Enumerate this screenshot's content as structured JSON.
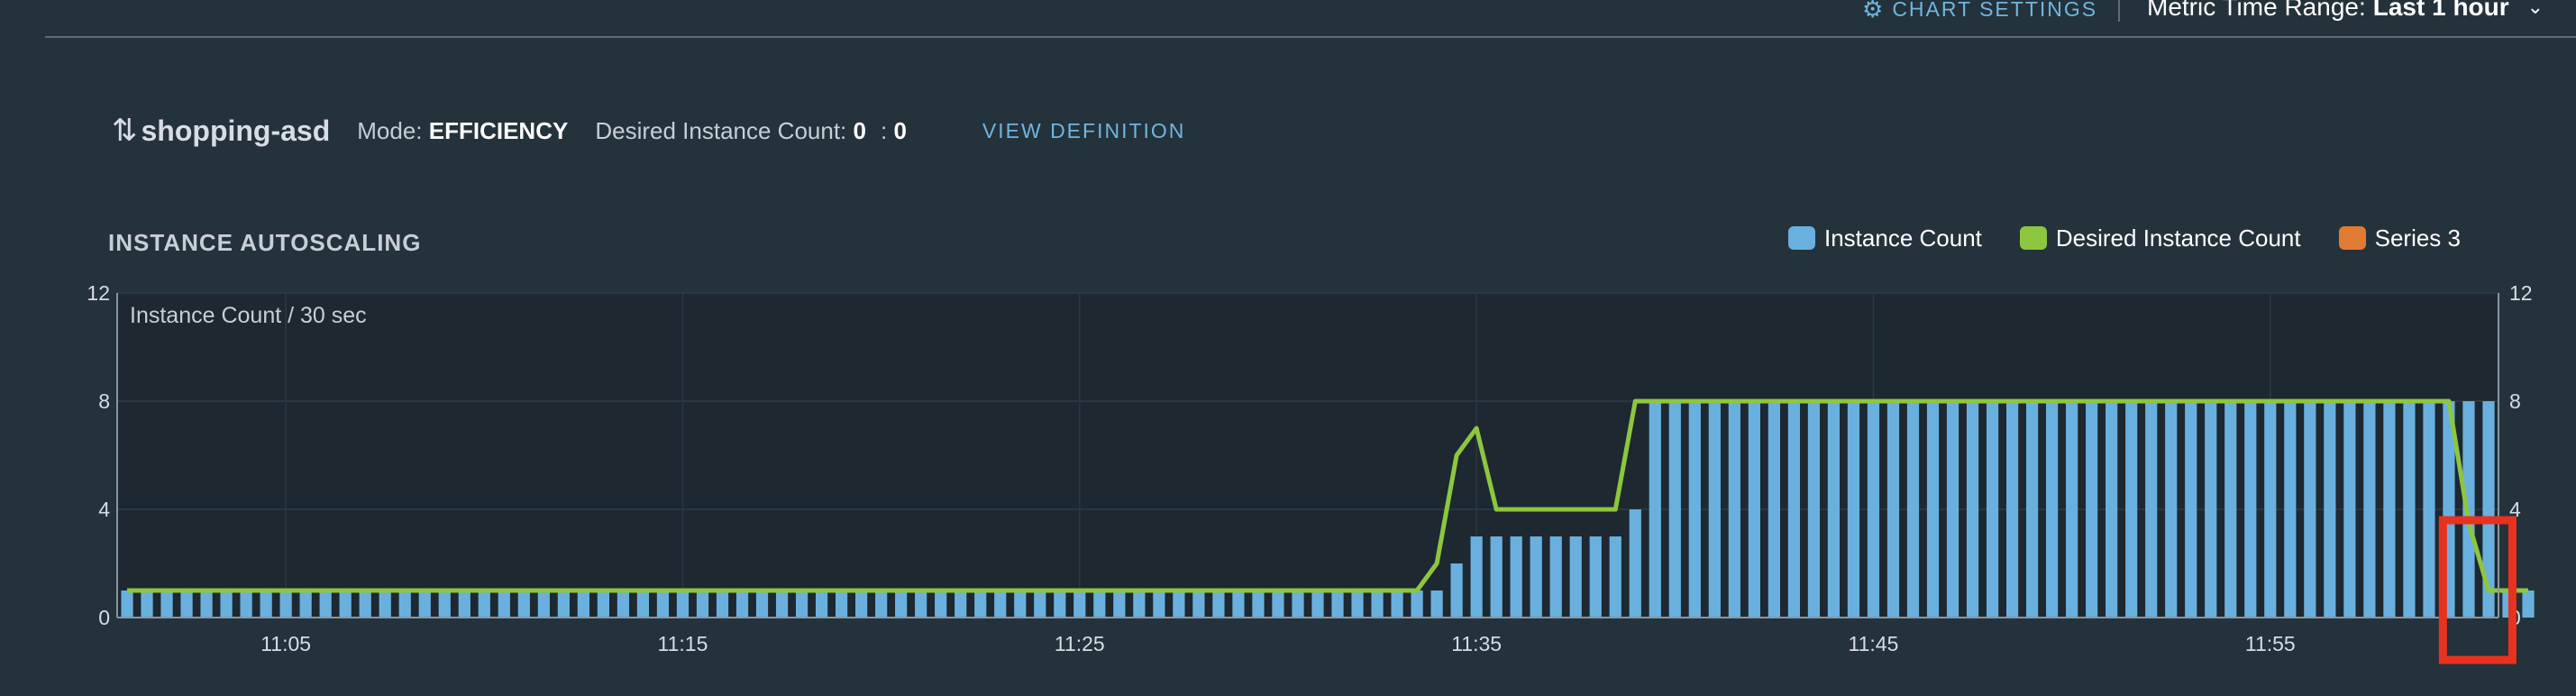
{
  "toolbar": {
    "chart_settings_label": "CHART SETTINGS",
    "time_range_label": "Metric Time Range:",
    "time_range_value": "Last 1 hour"
  },
  "header": {
    "app_name": "shopping-asd",
    "mode_label": "Mode:",
    "mode_value": "EFFICIENCY",
    "desired_label": "Desired Instance Count:",
    "desired_value": "0",
    "desired_second_value": "0",
    "view_definition_label": "VIEW DEFINITION"
  },
  "colors": {
    "instance_count": "#6ab0de",
    "desired_instance_count": "#8dc63f",
    "series_3": "#e07b32",
    "highlight": "#e8321f"
  },
  "chart_data": {
    "type": "bar",
    "title": "INSTANCE AUTOSCALING",
    "unit_label": "Instance Count / 30 sec",
    "ylim": [
      0,
      12
    ],
    "y_ticks": [
      "0",
      "4",
      "8",
      "12"
    ],
    "x_ticks": [
      {
        "label": "11:05",
        "index": 8
      },
      {
        "label": "11:15",
        "index": 28
      },
      {
        "label": "11:25",
        "index": 48
      },
      {
        "label": "11:35",
        "index": 68
      },
      {
        "label": "11:45",
        "index": 88
      },
      {
        "label": "11:55",
        "index": 108
      }
    ],
    "legend": [
      "Instance Count",
      "Desired Instance Count",
      "Series 3"
    ],
    "legend_position": "top-right",
    "x": [
      "11:01:00",
      "11:01:30",
      "11:02:00",
      "11:02:30",
      "11:03:00",
      "11:03:30",
      "11:04:00",
      "11:04:30",
      "11:05:00",
      "11:05:30",
      "11:06:00",
      "11:06:30",
      "11:07:00",
      "11:07:30",
      "11:08:00",
      "11:08:30",
      "11:09:00",
      "11:09:30",
      "11:10:00",
      "11:10:30",
      "11:11:00",
      "11:11:30",
      "11:12:00",
      "11:12:30",
      "11:13:00",
      "11:13:30",
      "11:14:00",
      "11:14:30",
      "11:15:00",
      "11:15:30",
      "11:16:00",
      "11:16:30",
      "11:17:00",
      "11:17:30",
      "11:18:00",
      "11:18:30",
      "11:19:00",
      "11:19:30",
      "11:20:00",
      "11:20:30",
      "11:21:00",
      "11:21:30",
      "11:22:00",
      "11:22:30",
      "11:23:00",
      "11:23:30",
      "11:24:00",
      "11:24:30",
      "11:25:00",
      "11:25:30",
      "11:26:00",
      "11:26:30",
      "11:27:00",
      "11:27:30",
      "11:28:00",
      "11:28:30",
      "11:29:00",
      "11:29:30",
      "11:30:00",
      "11:30:30",
      "11:31:00",
      "11:31:30",
      "11:32:00",
      "11:32:30",
      "11:33:00",
      "11:33:30",
      "11:34:00",
      "11:34:30",
      "11:35:00",
      "11:35:30",
      "11:36:00",
      "11:36:30",
      "11:37:00",
      "11:37:30",
      "11:38:00",
      "11:38:30",
      "11:39:00",
      "11:39:30",
      "11:40:00",
      "11:40:30",
      "11:41:00",
      "11:41:30",
      "11:42:00",
      "11:42:30",
      "11:43:00",
      "11:43:30",
      "11:44:00",
      "11:44:30",
      "11:45:00",
      "11:45:30",
      "11:46:00",
      "11:46:30",
      "11:47:00",
      "11:47:30",
      "11:48:00",
      "11:48:30",
      "11:49:00",
      "11:49:30",
      "11:50:00",
      "11:50:30",
      "11:51:00",
      "11:51:30",
      "11:52:00",
      "11:52:30",
      "11:53:00",
      "11:53:30",
      "11:54:00",
      "11:54:30",
      "11:55:00",
      "11:55:30",
      "11:56:00",
      "11:56:30",
      "11:57:00",
      "11:57:30",
      "11:58:00",
      "11:58:30",
      "11:59:00",
      "11:59:30",
      "12:00:00",
      "12:00:30"
    ],
    "series": [
      {
        "name": "Instance Count",
        "type": "bar",
        "values": [
          1,
          1,
          1,
          1,
          1,
          1,
          1,
          1,
          1,
          1,
          1,
          1,
          1,
          1,
          1,
          1,
          1,
          1,
          1,
          1,
          1,
          1,
          1,
          1,
          1,
          1,
          1,
          1,
          1,
          1,
          1,
          1,
          1,
          1,
          1,
          1,
          1,
          1,
          1,
          1,
          1,
          1,
          1,
          1,
          1,
          1,
          1,
          1,
          1,
          1,
          1,
          1,
          1,
          1,
          1,
          1,
          1,
          1,
          1,
          1,
          1,
          1,
          1,
          1,
          1,
          1,
          1,
          2,
          3,
          3,
          3,
          3,
          3,
          3,
          3,
          3,
          4,
          8,
          8,
          8,
          8,
          8,
          8,
          8,
          8,
          8,
          8,
          8,
          8,
          8,
          8,
          8,
          8,
          8,
          8,
          8,
          8,
          8,
          8,
          8,
          8,
          8,
          8,
          8,
          8,
          8,
          8,
          8,
          8,
          8,
          8,
          8,
          8,
          8,
          8,
          8,
          8,
          8,
          8,
          8,
          1,
          1
        ]
      },
      {
        "name": "Desired Instance Count",
        "type": "line",
        "values": [
          1,
          1,
          1,
          1,
          1,
          1,
          1,
          1,
          1,
          1,
          1,
          1,
          1,
          1,
          1,
          1,
          1,
          1,
          1,
          1,
          1,
          1,
          1,
          1,
          1,
          1,
          1,
          1,
          1,
          1,
          1,
          1,
          1,
          1,
          1,
          1,
          1,
          1,
          1,
          1,
          1,
          1,
          1,
          1,
          1,
          1,
          1,
          1,
          1,
          1,
          1,
          1,
          1,
          1,
          1,
          1,
          1,
          1,
          1,
          1,
          1,
          1,
          1,
          1,
          1,
          1,
          2,
          6,
          7,
          4,
          4,
          4,
          4,
          4,
          4,
          4,
          8,
          8,
          8,
          8,
          8,
          8,
          8,
          8,
          8,
          8,
          8,
          8,
          8,
          8,
          8,
          8,
          8,
          8,
          8,
          8,
          8,
          8,
          8,
          8,
          8,
          8,
          8,
          8,
          8,
          8,
          8,
          8,
          8,
          8,
          8,
          8,
          8,
          8,
          8,
          8,
          8,
          8,
          3.5,
          1,
          1,
          1
        ]
      },
      {
        "name": "Series 3",
        "type": "bar",
        "values": []
      }
    ]
  }
}
